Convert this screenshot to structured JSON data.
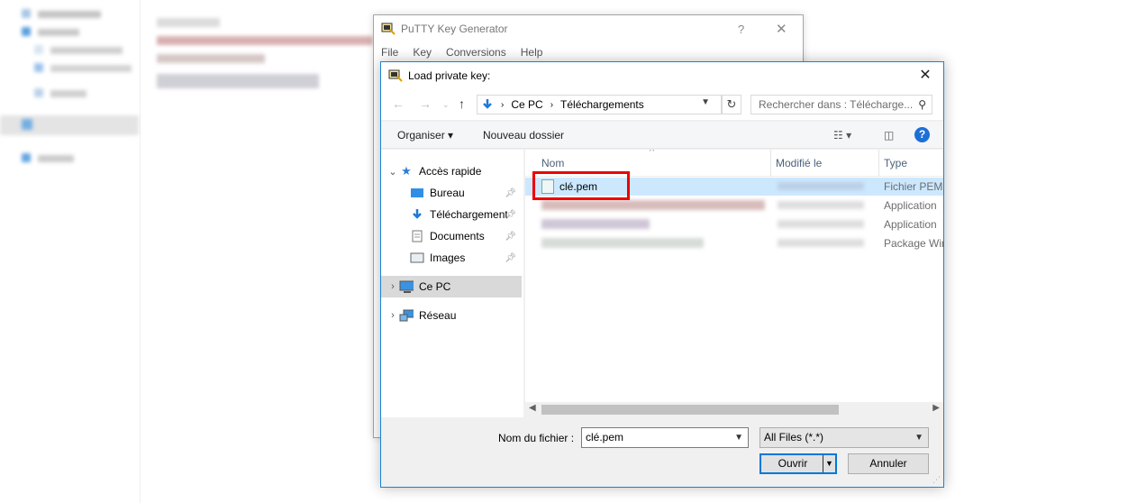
{
  "putty": {
    "title": "PuTTY Key Generator",
    "help": "?",
    "close": "✕",
    "menu": [
      "File",
      "Key",
      "Conversions",
      "Help"
    ]
  },
  "dialog": {
    "title": "Load private key:",
    "close": "✕",
    "breadcrumb": [
      "Ce PC",
      "Téléchargements"
    ],
    "search_placeholder": "Rechercher dans : Télécharge...",
    "toolbar": {
      "organize": "Organiser ▾",
      "new_folder": "Nouveau dossier",
      "help": "?"
    },
    "nav": [
      {
        "label": "Accès rapide",
        "icon": "star-icon"
      },
      {
        "label": "Bureau",
        "icon": "desktop-icon"
      },
      {
        "label": "Téléchargements",
        "icon": "download-icon"
      },
      {
        "label": "Documents",
        "icon": "document-icon"
      },
      {
        "label": "Images",
        "icon": "image-icon"
      },
      {
        "label": "Ce PC",
        "icon": "computer-icon"
      },
      {
        "label": "Réseau",
        "icon": "network-icon"
      }
    ],
    "columns": {
      "name": "Nom",
      "modified": "Modifié le",
      "type": "Type"
    },
    "files": [
      {
        "name": "clé.pem",
        "type": "Fichier PEM"
      },
      {
        "name": "",
        "type": "Application"
      },
      {
        "name": "",
        "type": "Application"
      },
      {
        "name": "",
        "type": "Package Win"
      }
    ],
    "filename_label": "Nom du fichier :",
    "filename_value": "clé.pem",
    "filter_value": "All Files (*.*)",
    "open_button": "Ouvrir",
    "cancel_button": "Annuler"
  },
  "colors": {
    "accent": "#0078d7",
    "selection": "#cce8ff",
    "highlight": "#e00000"
  }
}
